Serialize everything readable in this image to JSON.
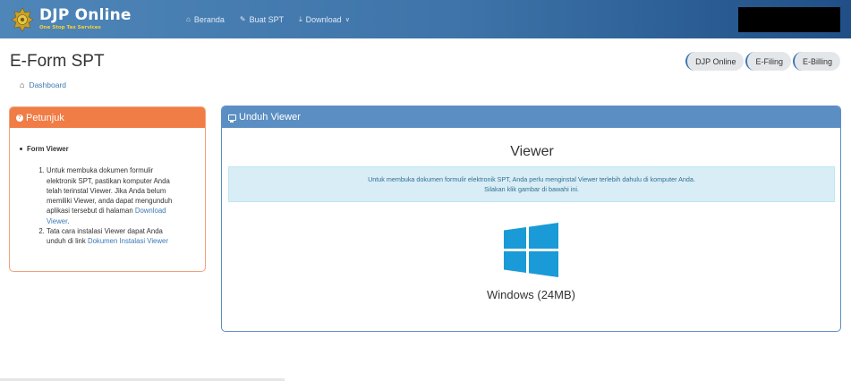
{
  "navbar": {
    "brand_title": "DJP Online",
    "brand_subtitle": "One Stop Tax Services",
    "menu": [
      {
        "icon": "home-icon",
        "label": "Beranda"
      },
      {
        "icon": "edit-icon",
        "label": "Buat SPT"
      },
      {
        "icon": "download-icon",
        "label": "Download"
      }
    ]
  },
  "page": {
    "title": "E-Form SPT",
    "breadcrumb": "Dashboard",
    "pills": [
      "DJP Online",
      "E-Filing",
      "E-Billing"
    ]
  },
  "petunjuk": {
    "title": "Petunjuk",
    "section": "Form Viewer",
    "step1_text": "Untuk membuka dokumen formulir elektronik SPT, pastikan komputer Anda telah terinstal Viewer. Jika Anda belum memiliki Viewer, anda dapat mengunduh aplikasi tersebut di halaman ",
    "step1_link": "Download Viewer",
    "step1_end": ".",
    "step2_text": "Tata cara instalasi Viewer dapat Anda unduh di link ",
    "step2_link": "Dokumen Instalasi Viewer"
  },
  "unduh": {
    "title": "Unduh Viewer",
    "viewer_heading": "Viewer",
    "info_line1": "Untuk membuka dokumen formulir elektronik SPT, Anda perlu menginstal Viewer terlebih dahulu di komputer Anda.",
    "info_line2": "Silakan klik gambar di bawahi ini.",
    "download_label": "Windows (24MB)"
  },
  "colors": {
    "navbar": "#4f86b9",
    "petunjuk_header": "#f07c46",
    "unduh_header": "#5b8fc3",
    "windows_logo": "#1a9ad6",
    "link": "#3b79b6"
  }
}
